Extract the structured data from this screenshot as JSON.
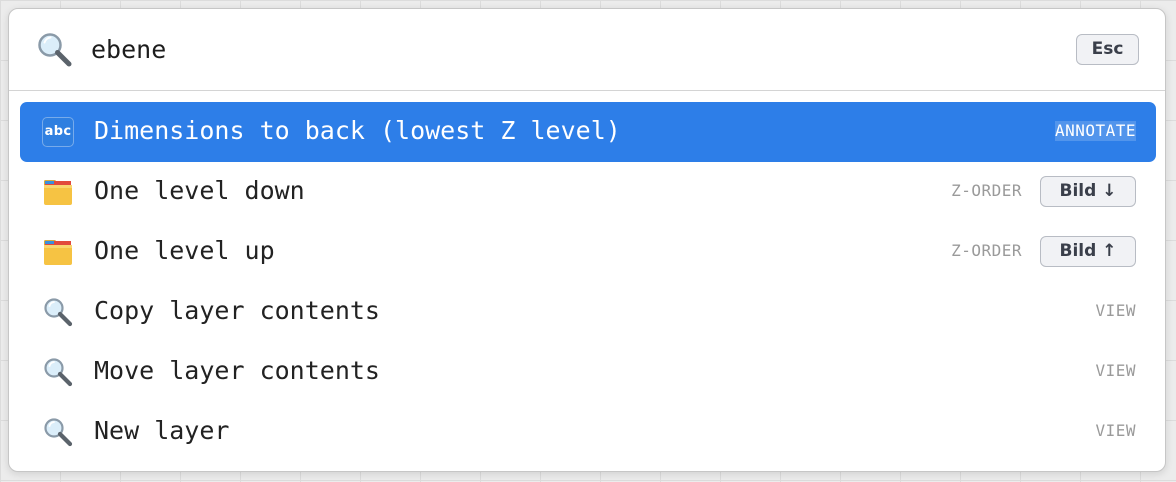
{
  "search": {
    "query": "ebene",
    "escape_key": "Esc"
  },
  "results": [
    {
      "icon": "abc-input-icon",
      "icon_text": "abc",
      "label": "Dimensions to back (lowest Z level)",
      "category": "ANNOTATE",
      "shortcut": null,
      "selected": true
    },
    {
      "icon": "folder-icon",
      "label": "One level down",
      "category": "Z-ORDER",
      "shortcut": "Bild ↓",
      "selected": false
    },
    {
      "icon": "folder-icon",
      "label": "One level up",
      "category": "Z-ORDER",
      "shortcut": "Bild ↑",
      "selected": false
    },
    {
      "icon": "magnifier-icon",
      "label": "Copy layer contents",
      "category": "VIEW",
      "shortcut": null,
      "selected": false
    },
    {
      "icon": "magnifier-icon",
      "label": "Move layer contents",
      "category": "VIEW",
      "shortcut": null,
      "selected": false
    },
    {
      "icon": "magnifier-icon",
      "label": "New layer",
      "category": "VIEW",
      "shortcut": null,
      "selected": false
    }
  ],
  "colors": {
    "selection": "#2d7ee8",
    "category_text": "#9a9a9a",
    "label_text": "#222222"
  }
}
